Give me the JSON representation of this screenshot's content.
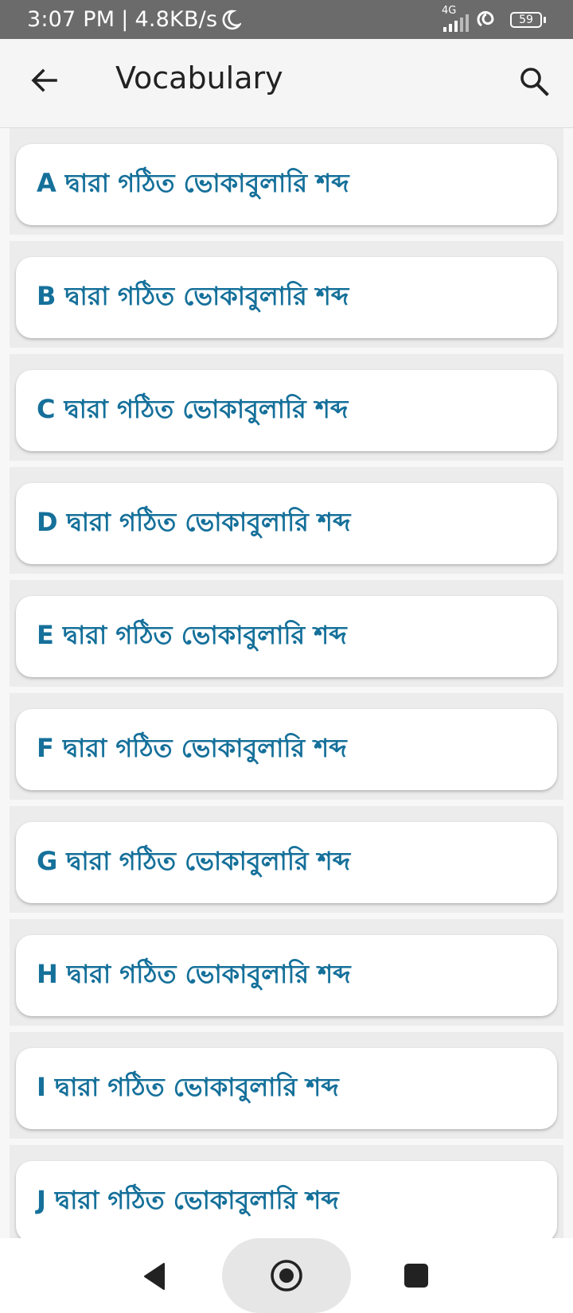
{
  "status_bar": {
    "time": "3:07 PM",
    "separator": "|",
    "speed": "4.8KB/s",
    "network": "4G",
    "battery": "59"
  },
  "app_bar": {
    "title": "Vocabulary",
    "back_icon": "arrow-left-icon",
    "search_icon": "search-icon"
  },
  "list": {
    "items": [
      {
        "label": "A দ্বারা গঠিত ভোকাবুলারি শব্দ"
      },
      {
        "label": "B দ্বারা গঠিত ভোকাবুলারি শব্দ"
      },
      {
        "label": "C দ্বারা গঠিত ভোকাবুলারি শব্দ"
      },
      {
        "label": "D দ্বারা গঠিত ভোকাবুলারি শব্দ"
      },
      {
        "label": "E দ্বারা গঠিত ভোকাবুলারি শব্দ"
      },
      {
        "label": "F দ্বারা গঠিত ভোকাবুলারি শব্দ"
      },
      {
        "label": "G দ্বারা গঠিত ভোকাবুলারি শব্দ"
      },
      {
        "label": "H দ্বারা গঠিত ভোকাবুলারি শব্দ"
      },
      {
        "label": "I দ্বারা গঠিত ভোকাবুলারি শব্দ"
      },
      {
        "label": "J দ্বারা গঠিত ভোকাবুলারি শব্দ"
      }
    ]
  },
  "colors": {
    "label_text": "#15709a",
    "status_bar": "#6b6b6b",
    "app_bar": "#f5f5f5"
  }
}
